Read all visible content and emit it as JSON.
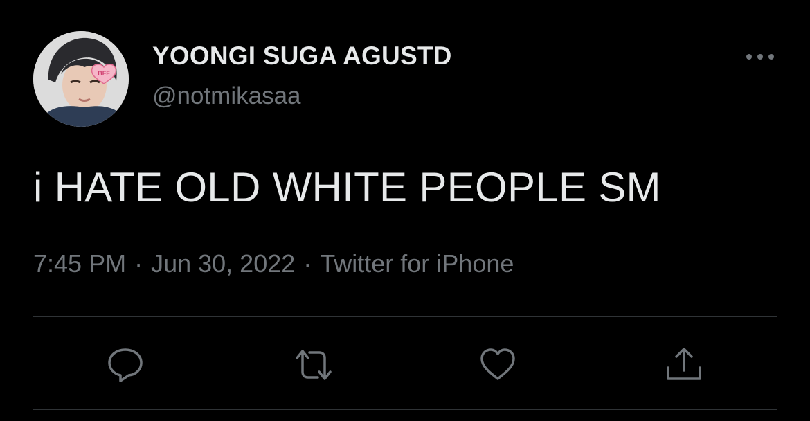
{
  "author": {
    "display_name": "YOONGI SUGA AGUSTD",
    "handle": "@notmikasaa",
    "avatar_badge": "BFF"
  },
  "tweet": {
    "text": "i HATE OLD WHITE PEOPLE SM",
    "time": "7:45 PM",
    "date": "Jun 30, 2022",
    "source": "Twitter for iPhone",
    "separator": "·"
  },
  "actions": [
    {
      "icon": "reply-icon"
    },
    {
      "icon": "retweet-icon"
    },
    {
      "icon": "like-icon"
    },
    {
      "icon": "share-icon"
    }
  ],
  "colors": {
    "background": "#000000",
    "primary_text": "#e7e9ea",
    "secondary_text": "#71767b",
    "divider": "#2f3336"
  }
}
